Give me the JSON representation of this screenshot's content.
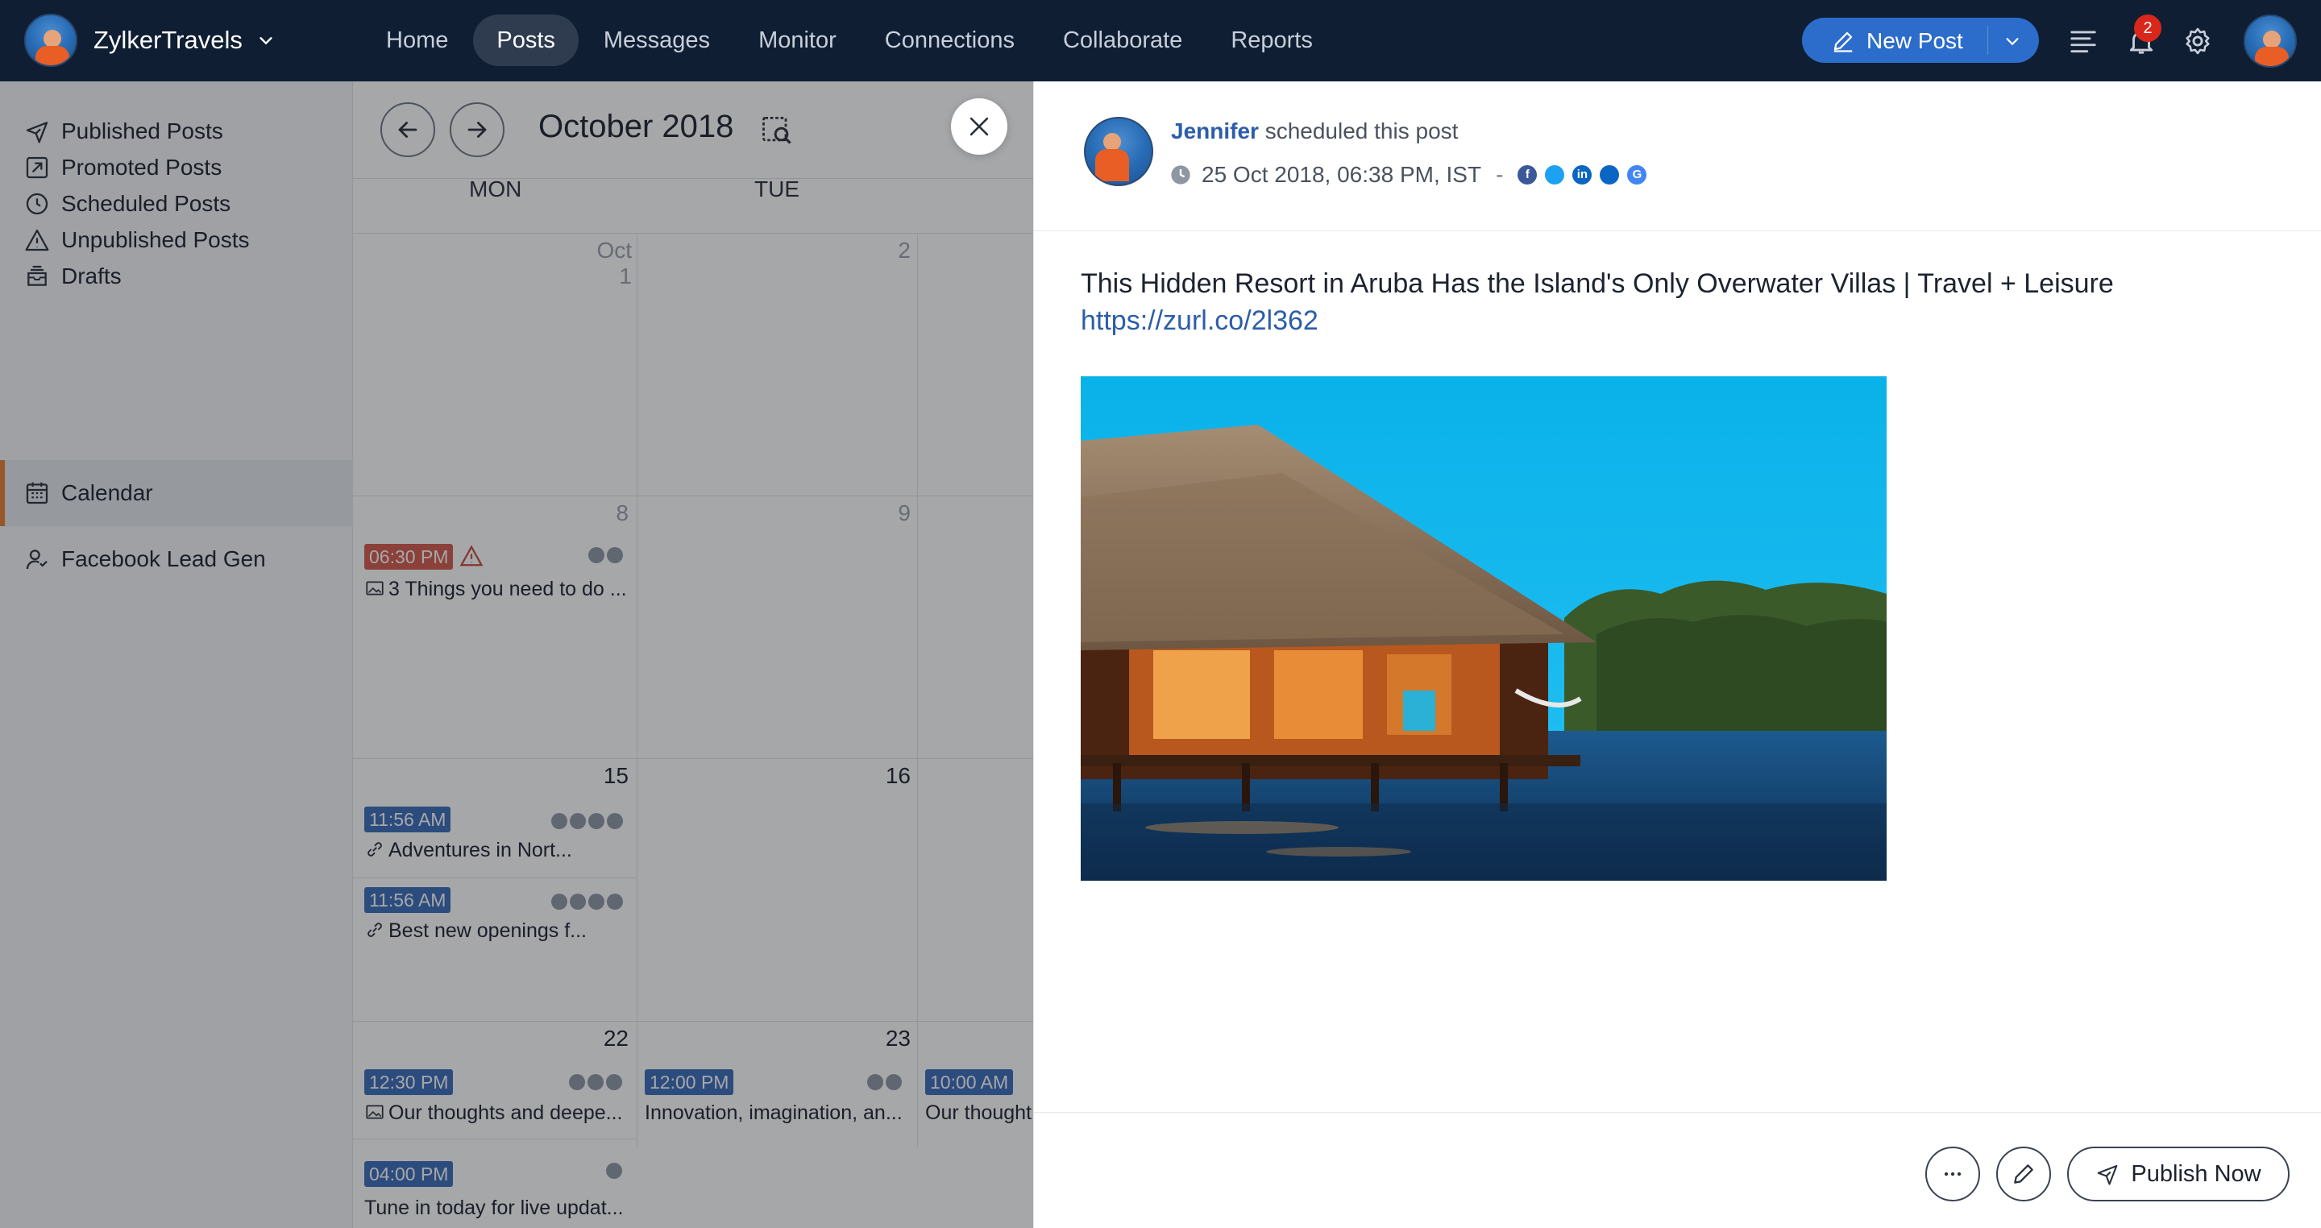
{
  "brand": {
    "name": "ZylkerTravels"
  },
  "nav": {
    "items": [
      {
        "label": "Home",
        "active": false
      },
      {
        "label": "Posts",
        "active": true
      },
      {
        "label": "Messages",
        "active": false
      },
      {
        "label": "Monitor",
        "active": false
      },
      {
        "label": "Connections",
        "active": false
      },
      {
        "label": "Collaborate",
        "active": false
      },
      {
        "label": "Reports",
        "active": false
      }
    ],
    "new_post_label": "New Post",
    "notification_count": "2"
  },
  "sidebar": {
    "items": [
      {
        "label": "Published Posts",
        "icon": "send-icon"
      },
      {
        "label": "Promoted Posts",
        "icon": "promote-icon"
      },
      {
        "label": "Scheduled Posts",
        "icon": "clock-icon"
      },
      {
        "label": "Unpublished Posts",
        "icon": "warning-icon"
      },
      {
        "label": "Drafts",
        "icon": "drafts-icon"
      },
      {
        "label": "Calendar",
        "icon": "calendar-icon",
        "active": true
      },
      {
        "label": "Facebook Lead Gen",
        "icon": "lead-gen-icon"
      }
    ]
  },
  "calendar": {
    "month_label": "October 2018",
    "weekdays": [
      "MON",
      "TUE"
    ],
    "dates": {
      "oct1": "Oct 1",
      "d2": "2",
      "d8": "8",
      "d9": "9",
      "d15": "15",
      "d16": "16",
      "d22": "22",
      "d23": "23"
    },
    "posts": {
      "p1": {
        "time": "06:30 PM",
        "title": "3 Things you need to do ...",
        "status": "failed"
      },
      "p2": {
        "time": "11:56 AM",
        "title": "Adventures in Nort..."
      },
      "p3": {
        "time": "11:56 AM",
        "title": "Best new openings f..."
      },
      "p4": {
        "time": "12:30 PM",
        "title": "Our thoughts and deepe..."
      },
      "p5": {
        "time": "04:00 PM",
        "title": "Tune in today for live updat..."
      },
      "p6": {
        "time": "12:00 PM",
        "title": "Innovation, imagination, an..."
      },
      "p7": {
        "time": "10:00 AM",
        "title": "Our thought"
      }
    }
  },
  "detail": {
    "author": "Jennifer",
    "action_text": "scheduled this post",
    "datetime": "25 Oct 2018, 06:38 PM, IST",
    "dash": "-",
    "networks": [
      "facebook",
      "twitter",
      "linkedin",
      "linkedin-page",
      "google-mybusiness"
    ],
    "post_text": "This Hidden Resort in Aruba Has the Island's Only Overwater Villas | Travel + Leisure",
    "post_link": "https://zurl.co/2l362",
    "publish_label": "Publish Now"
  },
  "colors": {
    "nav_bg": "#0f1e33",
    "accent": "#2c6ccb",
    "active_sidebar_border": "#e97d35",
    "failed_pill": "#d45a4c",
    "scheduled_pill": "#3b6cb8",
    "link": "#2c5da8"
  }
}
